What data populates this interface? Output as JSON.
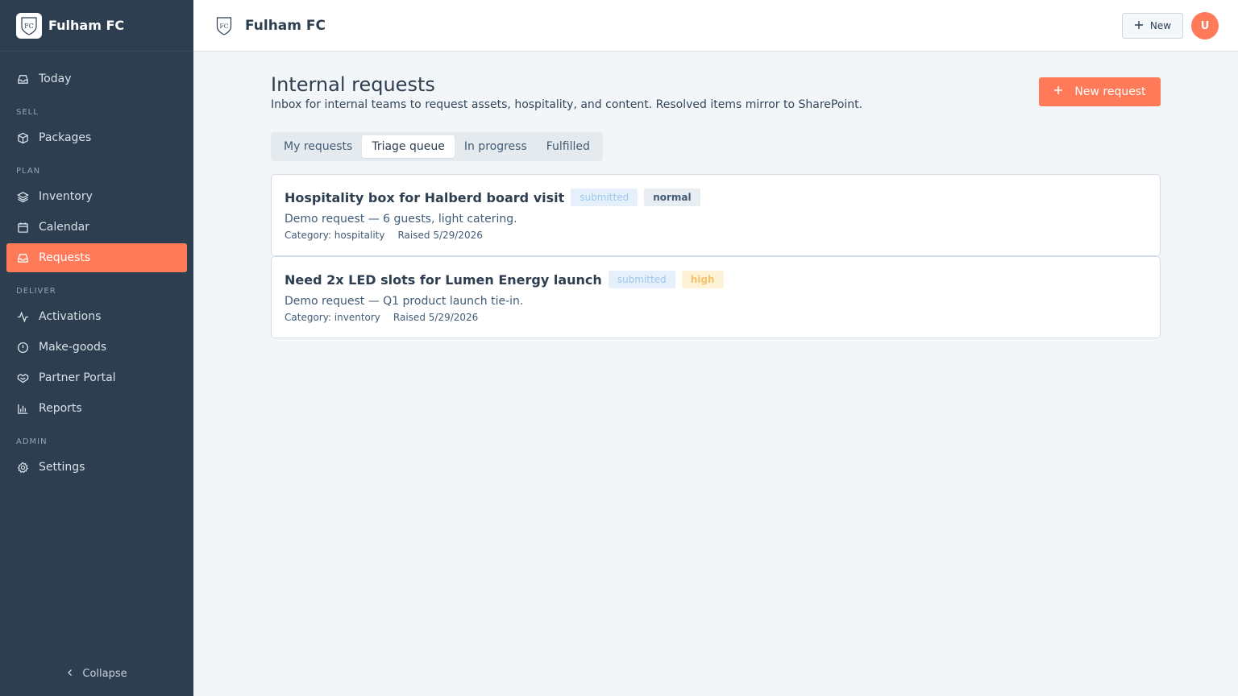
{
  "brand": {
    "name": "Fulham FC"
  },
  "sidebar": {
    "items": [
      {
        "label": "Today",
        "icon": "inbox-icon"
      },
      {
        "section": "SELL"
      },
      {
        "label": "Packages",
        "icon": "package-icon"
      },
      {
        "section": "PLAN"
      },
      {
        "label": "Inventory",
        "icon": "layers-icon"
      },
      {
        "label": "Calendar",
        "icon": "calendar-icon"
      },
      {
        "label": "Requests",
        "icon": "inbox-icon",
        "active": true
      },
      {
        "section": "DELIVER"
      },
      {
        "label": "Activations",
        "icon": "activity-icon"
      },
      {
        "label": "Make-goods",
        "icon": "alert-circle-icon"
      },
      {
        "label": "Partner Portal",
        "icon": "handshake-icon"
      },
      {
        "label": "Reports",
        "icon": "bar-chart-icon"
      },
      {
        "section": "ADMIN"
      },
      {
        "label": "Settings",
        "icon": "gear-icon"
      }
    ],
    "collapse_label": "Collapse"
  },
  "header": {
    "title": "Fulham FC",
    "new_label": "New",
    "avatar_initial": "U"
  },
  "main": {
    "title": "Internal requests",
    "subtitle": "Inbox for internal teams to request assets, hospitality, and content. Resolved items mirror to SharePoint.",
    "new_request_label": "New request",
    "tabs": [
      {
        "label": "My requests",
        "active": false
      },
      {
        "label": "Triage queue",
        "active": true
      },
      {
        "label": "In progress",
        "active": false
      },
      {
        "label": "Fulfilled",
        "active": false
      }
    ],
    "requests": [
      {
        "title": "Hospitality box for Halberd board visit",
        "status": "submitted",
        "priority": "normal",
        "description": "Demo request — 6 guests, light catering.",
        "category": "Category: hospitality",
        "raised": "Raised 5/29/2026"
      },
      {
        "title": "Need 2x LED slots for Lumen Energy launch",
        "status": "submitted",
        "priority": "high",
        "description": "Demo request — Q1 product launch tie-in.",
        "category": "Category: inventory",
        "raised": "Raised 5/29/2026"
      }
    ]
  },
  "colors": {
    "sidebar_bg": "#2d3e50",
    "accent": "#ff7a59",
    "page_bg": "#f3f6f9"
  }
}
